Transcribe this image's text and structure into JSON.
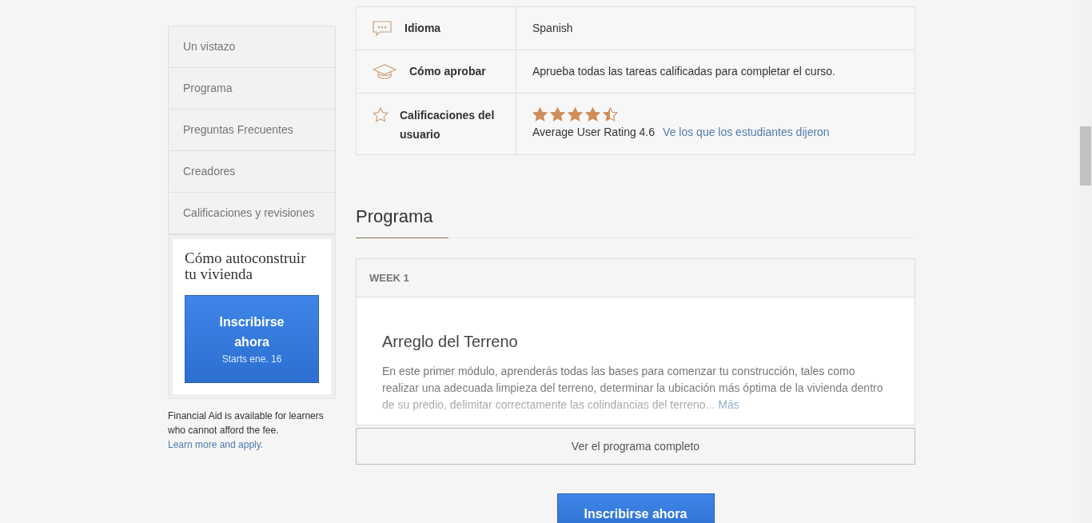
{
  "sidebar": {
    "items": [
      {
        "label": "Un vistazo"
      },
      {
        "label": "Programa"
      },
      {
        "label": "Preguntas Frecuentes"
      },
      {
        "label": "Creadores"
      },
      {
        "label": "Calificaciones y revisiones"
      }
    ],
    "enroll_card": {
      "title": "Cómo autoconstruir tu vivienda",
      "button": {
        "label": "Inscribirse ahora",
        "subtitle": "Starts ene. 16"
      }
    },
    "financial_aid": {
      "text": "Financial Aid is available for learners who cannot afford the fee.",
      "link": "Learn more and apply."
    }
  },
  "info_table": {
    "rows": [
      {
        "kind": "text",
        "label": "Idioma",
        "value": "Spanish"
      },
      {
        "kind": "text",
        "label": "Cómo aprobar",
        "value": "Aprueba todas las tareas calificadas para completar el curso."
      },
      {
        "kind": "rating",
        "label": "Calificaciones del usuario",
        "stars": 4.5,
        "value": "Average User Rating 4.6",
        "link": "Ve los que los estudiantes dijeron"
      }
    ]
  },
  "syllabus": {
    "heading": "Programa",
    "week": {
      "label": "WEEK 1",
      "module_title": "Arreglo del Terreno",
      "description": "En este primer módulo, aprenderás todas las bases para comenzar tu construcción, tales como realizar una adecuada limpieza del terreno, determinar la ubicación más óptima de la vivienda dentro de su predio, delimitar correctamente las colindancias del terreno...",
      "more_link": "Más"
    },
    "full_button": "Ver el programa completo"
  },
  "enroll_button": "Inscribirse ahora"
}
